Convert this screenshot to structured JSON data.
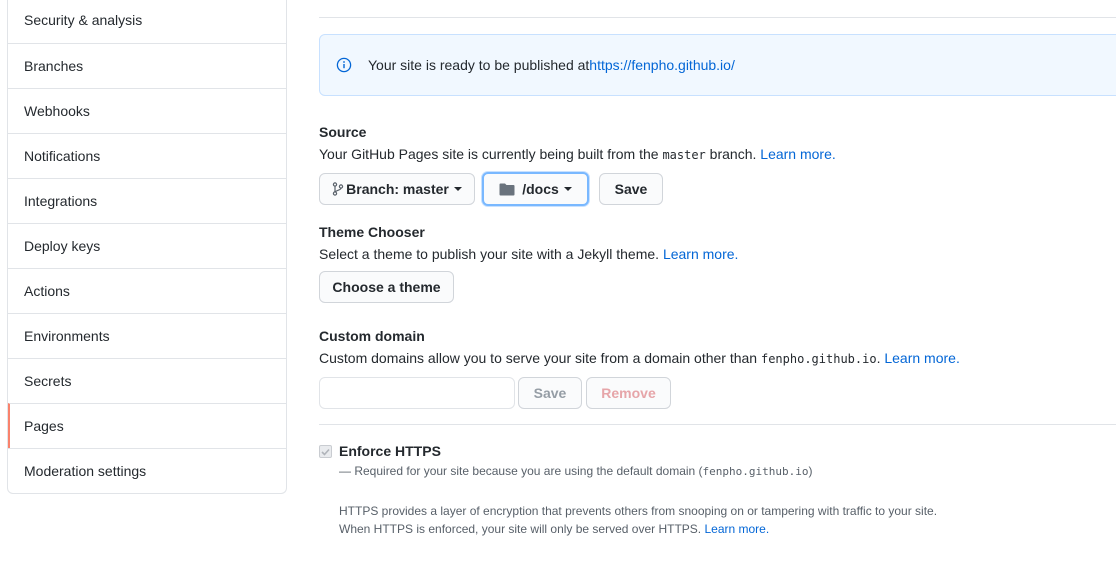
{
  "sidebar": {
    "items": [
      {
        "label": "Security & analysis",
        "active": false
      },
      {
        "label": "Branches",
        "active": false
      },
      {
        "label": "Webhooks",
        "active": false
      },
      {
        "label": "Notifications",
        "active": false
      },
      {
        "label": "Integrations",
        "active": false
      },
      {
        "label": "Deploy keys",
        "active": false
      },
      {
        "label": "Actions",
        "active": false
      },
      {
        "label": "Environments",
        "active": false
      },
      {
        "label": "Secrets",
        "active": false
      },
      {
        "label": "Pages",
        "active": true
      },
      {
        "label": "Moderation settings",
        "active": false
      }
    ],
    "active_accent": "#f9826c"
  },
  "flash": {
    "icon": "info-icon",
    "text": "Your site is ready to be published at ",
    "url": "https://fenpho.github.io/"
  },
  "source": {
    "title": "Source",
    "desc_before": "Your GitHub Pages site is currently being built from the ",
    "branch_code": "master",
    "desc_after": " branch. ",
    "learn_more": "Learn more.",
    "branch_button": "Branch: master",
    "folder_button": "/docs",
    "save_button": "Save"
  },
  "theme": {
    "title": "Theme Chooser",
    "desc": "Select a theme to publish your site with a Jekyll theme. ",
    "learn_more": "Learn more.",
    "button": "Choose a theme"
  },
  "custom_domain": {
    "title": "Custom domain",
    "desc_before": "Custom domains allow you to serve your site from a domain other than ",
    "domain_code": "fenpho.github.io",
    "desc_after": ". ",
    "learn_more": "Learn more.",
    "input_value": "",
    "save_button": "Save",
    "remove_button": "Remove"
  },
  "https": {
    "label": "Enforce HTTPS",
    "checked": true,
    "note_before": "— Required for your site because you are using the default domain (",
    "note_code": "fenpho.github.io",
    "note_after": ")",
    "info_line1": "HTTPS provides a layer of encryption that prevents others from snooping on or tampering with traffic to your site.",
    "info_line2": "When HTTPS is enforced, your site will only be served over HTTPS. ",
    "learn_more": "Learn more."
  },
  "colors": {
    "link": "#0366d6",
    "flash_bg": "#f1f8ff",
    "border": "#e1e4e8"
  }
}
